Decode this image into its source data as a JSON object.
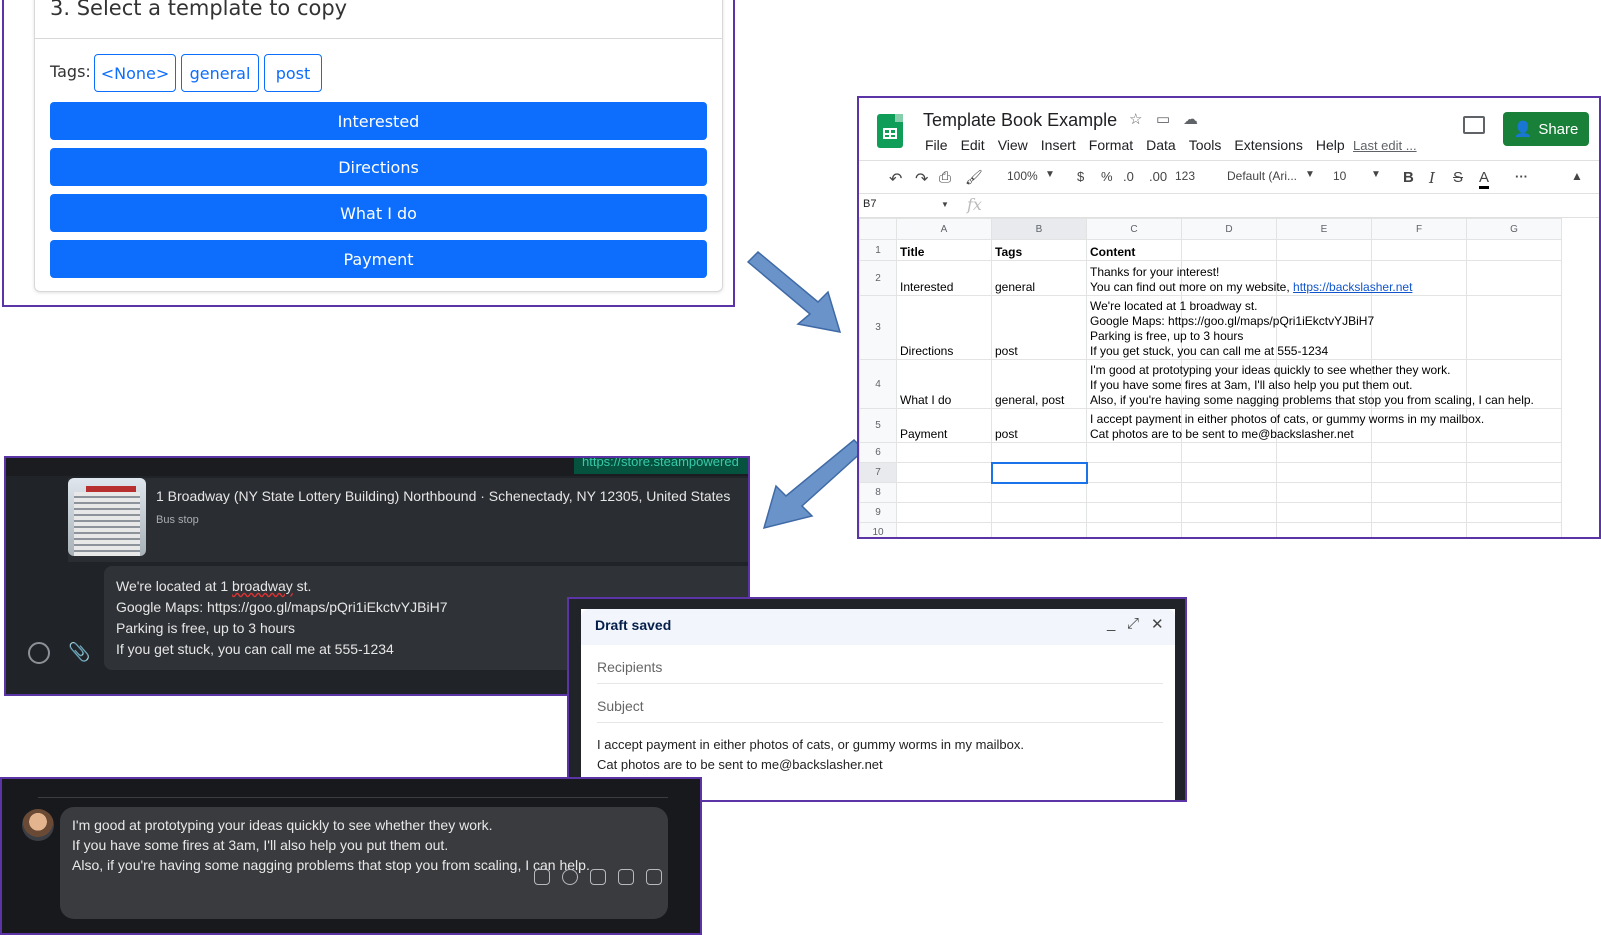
{
  "picker": {
    "heading": "3. Select a template to copy",
    "tags_label": "Tags:",
    "tags": [
      "<None>",
      "general",
      "post"
    ],
    "templates": [
      "Interested",
      "Directions",
      "What I do",
      "Payment"
    ]
  },
  "sheets": {
    "doc_title": "Template Book Example",
    "menu": [
      "File",
      "Edit",
      "View",
      "Insert",
      "Format",
      "Data",
      "Tools",
      "Extensions",
      "Help"
    ],
    "last_edit": "Last edit ...",
    "share_label": "Share",
    "toolbar": {
      "zoom": "100%",
      "currency": "$",
      "percent": "%",
      "dec_less": ".0",
      "dec_more": ".00",
      "format_more": "123",
      "font": "Default (Ari...",
      "font_size": "10",
      "bold": "B",
      "italic": "I",
      "strike": "S",
      "text_color": "A",
      "more": "···"
    },
    "name_box": "B7",
    "fx": "fx",
    "columns": [
      "A",
      "B",
      "C",
      "D",
      "E",
      "F",
      "G"
    ],
    "rows": [
      {
        "num": "1",
        "title": "Title",
        "tags": "Tags",
        "content": [
          "Content"
        ]
      },
      {
        "num": "2",
        "title": "Interested",
        "tags": "general",
        "content": [
          "Thanks for your interest!",
          "You can find out more on my website, "
        ],
        "link": "https://backslasher.net"
      },
      {
        "num": "3",
        "title": "Directions",
        "tags": "post",
        "content": [
          "We're located at 1 broadway st.",
          "Google Maps: https://goo.gl/maps/pQri1iEkctvYJBiH7",
          "Parking is free, up to 3 hours",
          "If you get stuck, you can call me at 555-1234"
        ]
      },
      {
        "num": "4",
        "title": "What I do",
        "tags": "general, post",
        "content": [
          "I'm good at prototyping your ideas quickly to see whether they work.",
          "If you have some fires at 3am, I'll also help you put them out.",
          "Also, if you're having some nagging problems that stop you from scaling, I can help."
        ]
      },
      {
        "num": "5",
        "title": "Payment",
        "tags": "post",
        "content": [
          "I accept payment in either photos of cats, or gummy worms in my mailbox.",
          "Cat photos are to be sent to me@backslasher.net"
        ]
      },
      {
        "num": "6"
      },
      {
        "num": "7"
      },
      {
        "num": "8"
      },
      {
        "num": "9"
      },
      {
        "num": "10"
      }
    ]
  },
  "chat1": {
    "url_chip": "https://store.steampowered",
    "location_title": "1 Broadway (NY State Lottery Building) Northbound · Schenectady, NY 12305, United States",
    "location_sub": "Bus stop",
    "message": {
      "l1a": "We're located at 1 ",
      "l1b": "broadway",
      "l1c": " st.",
      "l2": "Google Maps: https://goo.gl/maps/pQri1iEkctvYJBiH7",
      "l3": "Parking is free, up to 3 hours",
      "l4": "If you get stuck, you can call me at 555-1234"
    }
  },
  "gmail": {
    "header": "Draft saved",
    "recipients": "Recipients",
    "subject": "Subject",
    "body_l1": "I accept payment in either photos of cats, or gummy worms in my mailbox.",
    "body_l2": "Cat photos are to be sent to me@backslasher.net"
  },
  "chat2": {
    "l1": "I'm good at prototyping your ideas quickly to see whether they work.",
    "l2": "If you have some fires at 3am, I'll also help you put them out.",
    "l3": "Also, if you're having some nagging problems that stop you from scaling, I can help."
  }
}
